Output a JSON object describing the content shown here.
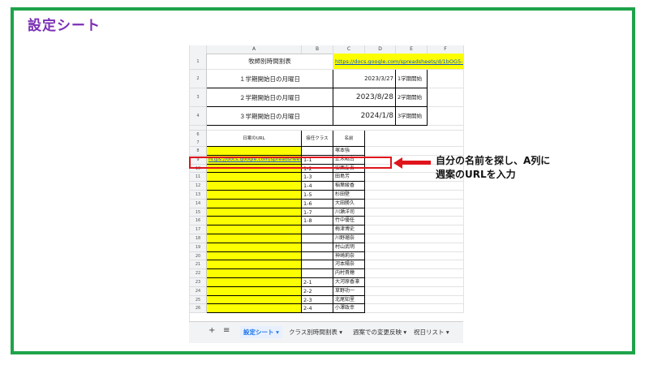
{
  "slide": {
    "title": "設定シート"
  },
  "columns": [
    "A",
    "B",
    "C",
    "D",
    "E",
    "F"
  ],
  "header_rows": [
    {
      "num": "1",
      "a": "牧師別時間割表",
      "c": "https://docs.google.com/spreadsheets/d/1bOG5-t"
    },
    {
      "num": "2",
      "a": "１学期開始日の月曜日",
      "c": "2023/3/27",
      "e": "1学期開始"
    },
    {
      "num": "3",
      "a": "２学期開始日の月曜日",
      "c": "2023/8/28",
      "e": "2学期開始"
    },
    {
      "num": "4",
      "a": "３学期開始日の月曜日",
      "c": "2024/1/8",
      "e": "3学期開始"
    }
  ],
  "table_header": {
    "a": "日案のURL",
    "b": "接任クラス",
    "c": "名前"
  },
  "data_rows": [
    {
      "num": "8",
      "a": "",
      "b": "",
      "c": "塚本強"
    },
    {
      "num": "9",
      "a": "https://docs.google.com/spreadsheets",
      "b": "1-1",
      "c": "止木昭台"
    },
    {
      "num": "10",
      "a": "",
      "b": "1-2",
      "c": "安西友吾"
    },
    {
      "num": "11",
      "a": "",
      "b": "1-3",
      "c": "田島芳"
    },
    {
      "num": "12",
      "a": "",
      "b": "1-4",
      "c": "稲葉綾香"
    },
    {
      "num": "13",
      "a": "",
      "b": "1-5",
      "c": "杉田壁"
    },
    {
      "num": "14",
      "a": "",
      "b": "1-6",
      "c": "大田勝久"
    },
    {
      "num": "15",
      "a": "",
      "b": "1-7",
      "c": "川瀬洋司"
    },
    {
      "num": "16",
      "a": "",
      "b": "1-8",
      "c": "竹中優任"
    },
    {
      "num": "17",
      "a": "",
      "b": "",
      "c": "梅津博史"
    },
    {
      "num": "18",
      "a": "",
      "b": "",
      "c": "川野瑠奈"
    },
    {
      "num": "19",
      "a": "",
      "b": "",
      "c": "村山武明"
    },
    {
      "num": "20",
      "a": "",
      "b": "",
      "c": "神崎莉奈"
    },
    {
      "num": "21",
      "a": "",
      "b": "",
      "c": "河本陽奈"
    },
    {
      "num": "22",
      "a": "",
      "b": "",
      "c": "内村貴穂"
    },
    {
      "num": "23",
      "a": "",
      "b": "2-1",
      "c": "大河原香凛"
    },
    {
      "num": "24",
      "a": "",
      "b": "2-2",
      "c": "草野功一"
    },
    {
      "num": "25",
      "a": "",
      "b": "2-3",
      "c": "北尾知里"
    },
    {
      "num": "26",
      "a": "",
      "b": "2-4",
      "c": "小澤政幸"
    }
  ],
  "tabs": [
    "設定シート",
    "クラス別時間割表",
    "週案での変更反映",
    "祝日リスト"
  ],
  "annotation": {
    "line1": "自分の名前を探し、A列に",
    "line2": "週案のURLを入力"
  },
  "colors": {
    "frame": "#1ea34a",
    "title": "#7b2fb5",
    "highlight": "#fbff00",
    "callout": "#e0141c"
  }
}
